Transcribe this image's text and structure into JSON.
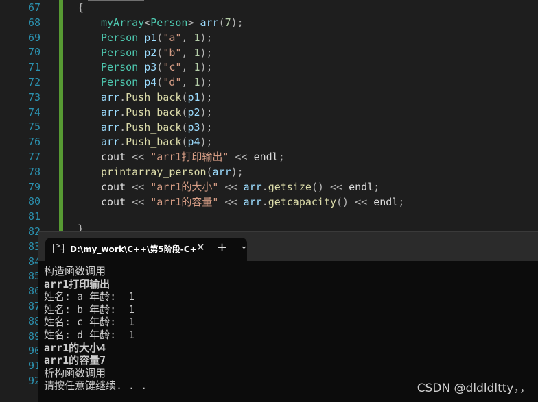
{
  "editor": {
    "line_numbers": [
      "67",
      "68",
      "69",
      "70",
      "71",
      "72",
      "73",
      "74",
      "75",
      "76",
      "77",
      "78",
      "79",
      "80",
      "81",
      "82",
      "83",
      "84",
      "85",
      "86",
      "87",
      "88",
      "89",
      "90",
      "91",
      "92"
    ],
    "open_brace": "{",
    "close_brace": "}",
    "lines": [
      [
        {
          "t": "myArray",
          "c": "cls"
        },
        {
          "t": "<",
          "c": "op"
        },
        {
          "t": "Person",
          "c": "cls"
        },
        {
          "t": "> ",
          "c": "op"
        },
        {
          "t": "arr",
          "c": "var"
        },
        {
          "t": "(",
          "c": "op"
        },
        {
          "t": "7",
          "c": "num"
        },
        {
          "t": ");",
          "c": "op"
        }
      ],
      [
        {
          "t": "Person ",
          "c": "cls"
        },
        {
          "t": "p1",
          "c": "var"
        },
        {
          "t": "(",
          "c": "op"
        },
        {
          "t": "\"a\"",
          "c": "str"
        },
        {
          "t": ", ",
          "c": "op"
        },
        {
          "t": "1",
          "c": "num"
        },
        {
          "t": ");",
          "c": "op"
        }
      ],
      [
        {
          "t": "Person ",
          "c": "cls"
        },
        {
          "t": "p2",
          "c": "var"
        },
        {
          "t": "(",
          "c": "op"
        },
        {
          "t": "\"b\"",
          "c": "str"
        },
        {
          "t": ", ",
          "c": "op"
        },
        {
          "t": "1",
          "c": "num"
        },
        {
          "t": ");",
          "c": "op"
        }
      ],
      [
        {
          "t": "Person ",
          "c": "cls"
        },
        {
          "t": "p3",
          "c": "var"
        },
        {
          "t": "(",
          "c": "op"
        },
        {
          "t": "\"c\"",
          "c": "str"
        },
        {
          "t": ", ",
          "c": "op"
        },
        {
          "t": "1",
          "c": "num"
        },
        {
          "t": ");",
          "c": "op"
        }
      ],
      [
        {
          "t": "Person ",
          "c": "cls"
        },
        {
          "t": "p4",
          "c": "var"
        },
        {
          "t": "(",
          "c": "op"
        },
        {
          "t": "\"d\"",
          "c": "str"
        },
        {
          "t": ", ",
          "c": "op"
        },
        {
          "t": "1",
          "c": "num"
        },
        {
          "t": ");",
          "c": "op"
        }
      ],
      [
        {
          "t": "arr",
          "c": "var"
        },
        {
          "t": ".",
          "c": "op"
        },
        {
          "t": "Push_back",
          "c": "fn"
        },
        {
          "t": "(",
          "c": "op"
        },
        {
          "t": "p1",
          "c": "var"
        },
        {
          "t": ");",
          "c": "op"
        }
      ],
      [
        {
          "t": "arr",
          "c": "var"
        },
        {
          "t": ".",
          "c": "op"
        },
        {
          "t": "Push_back",
          "c": "fn"
        },
        {
          "t": "(",
          "c": "op"
        },
        {
          "t": "p2",
          "c": "var"
        },
        {
          "t": ");",
          "c": "op"
        }
      ],
      [
        {
          "t": "arr",
          "c": "var"
        },
        {
          "t": ".",
          "c": "op"
        },
        {
          "t": "Push_back",
          "c": "fn"
        },
        {
          "t": "(",
          "c": "op"
        },
        {
          "t": "p3",
          "c": "var"
        },
        {
          "t": ");",
          "c": "op"
        }
      ],
      [
        {
          "t": "arr",
          "c": "var"
        },
        {
          "t": ".",
          "c": "op"
        },
        {
          "t": "Push_back",
          "c": "fn"
        },
        {
          "t": "(",
          "c": "op"
        },
        {
          "t": "p4",
          "c": "var"
        },
        {
          "t": ");",
          "c": "op"
        }
      ],
      [
        {
          "t": "cout ",
          "c": "plain"
        },
        {
          "t": "<< ",
          "c": "op"
        },
        {
          "t": "\"arr1打印输出\"",
          "c": "str"
        },
        {
          "t": " << ",
          "c": "op"
        },
        {
          "t": "endl",
          "c": "plain"
        },
        {
          "t": ";",
          "c": "op"
        }
      ],
      [
        {
          "t": "printarray_person",
          "c": "fn"
        },
        {
          "t": "(",
          "c": "op"
        },
        {
          "t": "arr",
          "c": "var"
        },
        {
          "t": ");",
          "c": "op"
        }
      ],
      [
        {
          "t": "cout ",
          "c": "plain"
        },
        {
          "t": "<< ",
          "c": "op"
        },
        {
          "t": "\"arr1的大小\"",
          "c": "str"
        },
        {
          "t": " << ",
          "c": "op"
        },
        {
          "t": "arr",
          "c": "var"
        },
        {
          "t": ".",
          "c": "op"
        },
        {
          "t": "getsize",
          "c": "fn"
        },
        {
          "t": "() << ",
          "c": "op"
        },
        {
          "t": "endl",
          "c": "plain"
        },
        {
          "t": ";",
          "c": "op"
        }
      ],
      [
        {
          "t": "cout ",
          "c": "plain"
        },
        {
          "t": "<< ",
          "c": "op"
        },
        {
          "t": "\"arr1的容量\"",
          "c": "str"
        },
        {
          "t": " << ",
          "c": "op"
        },
        {
          "t": "arr",
          "c": "var"
        },
        {
          "t": ".",
          "c": "op"
        },
        {
          "t": "getcapacity",
          "c": "fn"
        },
        {
          "t": "() << ",
          "c": "op"
        },
        {
          "t": "endl",
          "c": "plain"
        },
        {
          "t": ";",
          "c": "op"
        }
      ]
    ]
  },
  "terminal": {
    "tab_title": "D:\\my_work\\C++\\第5阶段-C+",
    "tab_icon_glyph": ">_",
    "close_glyph": "✕",
    "new_tab_glyph": "+",
    "dropdown_glyph": "⌄",
    "output": [
      "构造函数调用",
      "arr1打印输出",
      "姓名: a 年龄:  1",
      "姓名: b 年龄:  1",
      "姓名: c 年龄:  1",
      "姓名: d 年龄:  1",
      "arr1的大小4",
      "arr1的容量7",
      "析构函数调用",
      "请按任意键继续. . ."
    ]
  },
  "watermark": "CSDN @dldldltty，，"
}
